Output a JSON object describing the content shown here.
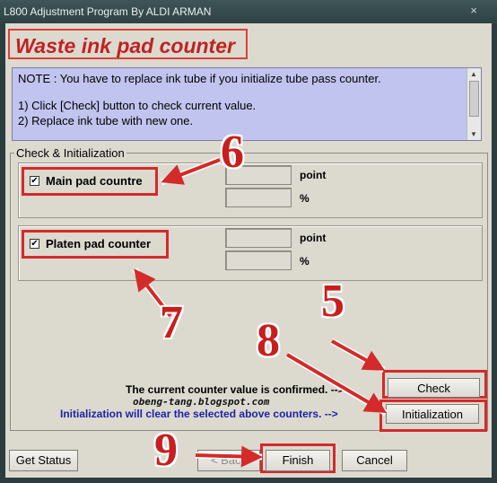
{
  "window": {
    "title": "L800 Adjustment Program By ALDI ARMAN",
    "close_glyph": "×"
  },
  "heading": "Waste ink pad counter",
  "note": {
    "line1": "NOTE : You have to replace ink tube if you initialize tube pass counter.",
    "line2": "1) Click [Check] button to check current value.",
    "line3": "2) Replace ink tube with new one."
  },
  "group": {
    "label": "Check & Initialization",
    "counters": [
      {
        "label": "Main pad countre",
        "checked": true,
        "unit_point": "point",
        "unit_percent": "%"
      },
      {
        "label": "Platen pad counter",
        "checked": true,
        "unit_point": "point",
        "unit_percent": "%"
      }
    ],
    "status_confirm": "The current counter value is confirmed. -->",
    "status_clear": "Initialization will clear the selected above counters. -->"
  },
  "buttons": {
    "check": "Check",
    "initialization": "Initialization",
    "get_status": "Get Status",
    "back": "< Back",
    "finish": "Finish",
    "cancel": "Cancel"
  },
  "annotations": {
    "watermark": "obeng-tang.blogspot.com",
    "n5": "5",
    "n6": "6",
    "n7": "7",
    "n8": "8",
    "n9": "9"
  },
  "colors": {
    "annotation_red": "#d32a2a",
    "note_bg": "#c1c4ee",
    "heading_red": "#c02222"
  }
}
